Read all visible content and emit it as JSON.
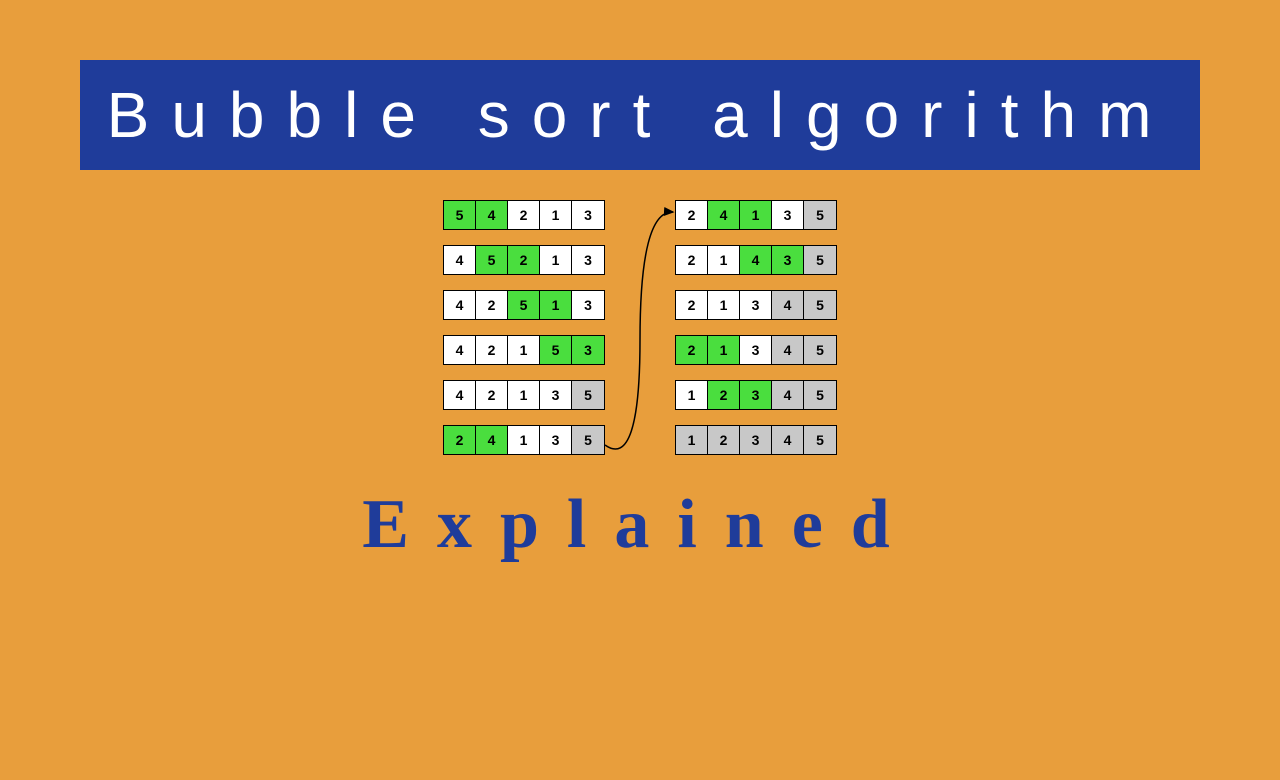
{
  "title": "Bubble sort algorithm",
  "subtitle": "Explained",
  "colors": {
    "background": "#e89e3c",
    "title_bg": "#1f3c9a",
    "title_fg": "#ffffff",
    "subtitle_fg": "#1f3c9a",
    "cell_white": "#ffffff",
    "cell_green": "#4ade3e",
    "cell_gray": "#c8c8c8"
  },
  "left_column": [
    [
      {
        "v": 5,
        "c": "green"
      },
      {
        "v": 4,
        "c": "green"
      },
      {
        "v": 2,
        "c": "white"
      },
      {
        "v": 1,
        "c": "white"
      },
      {
        "v": 3,
        "c": "white"
      }
    ],
    [
      {
        "v": 4,
        "c": "white"
      },
      {
        "v": 5,
        "c": "green"
      },
      {
        "v": 2,
        "c": "green"
      },
      {
        "v": 1,
        "c": "white"
      },
      {
        "v": 3,
        "c": "white"
      }
    ],
    [
      {
        "v": 4,
        "c": "white"
      },
      {
        "v": 2,
        "c": "white"
      },
      {
        "v": 5,
        "c": "green"
      },
      {
        "v": 1,
        "c": "green"
      },
      {
        "v": 3,
        "c": "white"
      }
    ],
    [
      {
        "v": 4,
        "c": "white"
      },
      {
        "v": 2,
        "c": "white"
      },
      {
        "v": 1,
        "c": "white"
      },
      {
        "v": 5,
        "c": "green"
      },
      {
        "v": 3,
        "c": "green"
      }
    ],
    [
      {
        "v": 4,
        "c": "white"
      },
      {
        "v": 2,
        "c": "white"
      },
      {
        "v": 1,
        "c": "white"
      },
      {
        "v": 3,
        "c": "white"
      },
      {
        "v": 5,
        "c": "gray"
      }
    ],
    [
      {
        "v": 2,
        "c": "green"
      },
      {
        "v": 4,
        "c": "green"
      },
      {
        "v": 1,
        "c": "white"
      },
      {
        "v": 3,
        "c": "white"
      },
      {
        "v": 5,
        "c": "gray"
      }
    ]
  ],
  "right_column": [
    [
      {
        "v": 2,
        "c": "white"
      },
      {
        "v": 4,
        "c": "green"
      },
      {
        "v": 1,
        "c": "green"
      },
      {
        "v": 3,
        "c": "white"
      },
      {
        "v": 5,
        "c": "gray"
      }
    ],
    [
      {
        "v": 2,
        "c": "white"
      },
      {
        "v": 1,
        "c": "white"
      },
      {
        "v": 4,
        "c": "green"
      },
      {
        "v": 3,
        "c": "green"
      },
      {
        "v": 5,
        "c": "gray"
      }
    ],
    [
      {
        "v": 2,
        "c": "white"
      },
      {
        "v": 1,
        "c": "white"
      },
      {
        "v": 3,
        "c": "white"
      },
      {
        "v": 4,
        "c": "gray"
      },
      {
        "v": 5,
        "c": "gray"
      }
    ],
    [
      {
        "v": 2,
        "c": "green"
      },
      {
        "v": 1,
        "c": "green"
      },
      {
        "v": 3,
        "c": "white"
      },
      {
        "v": 4,
        "c": "gray"
      },
      {
        "v": 5,
        "c": "gray"
      }
    ],
    [
      {
        "v": 1,
        "c": "white"
      },
      {
        "v": 2,
        "c": "green"
      },
      {
        "v": 3,
        "c": "green"
      },
      {
        "v": 4,
        "c": "gray"
      },
      {
        "v": 5,
        "c": "gray"
      }
    ],
    [
      {
        "v": 1,
        "c": "gray"
      },
      {
        "v": 2,
        "c": "gray"
      },
      {
        "v": 3,
        "c": "gray"
      },
      {
        "v": 4,
        "c": "gray"
      },
      {
        "v": 5,
        "c": "gray"
      }
    ]
  ]
}
